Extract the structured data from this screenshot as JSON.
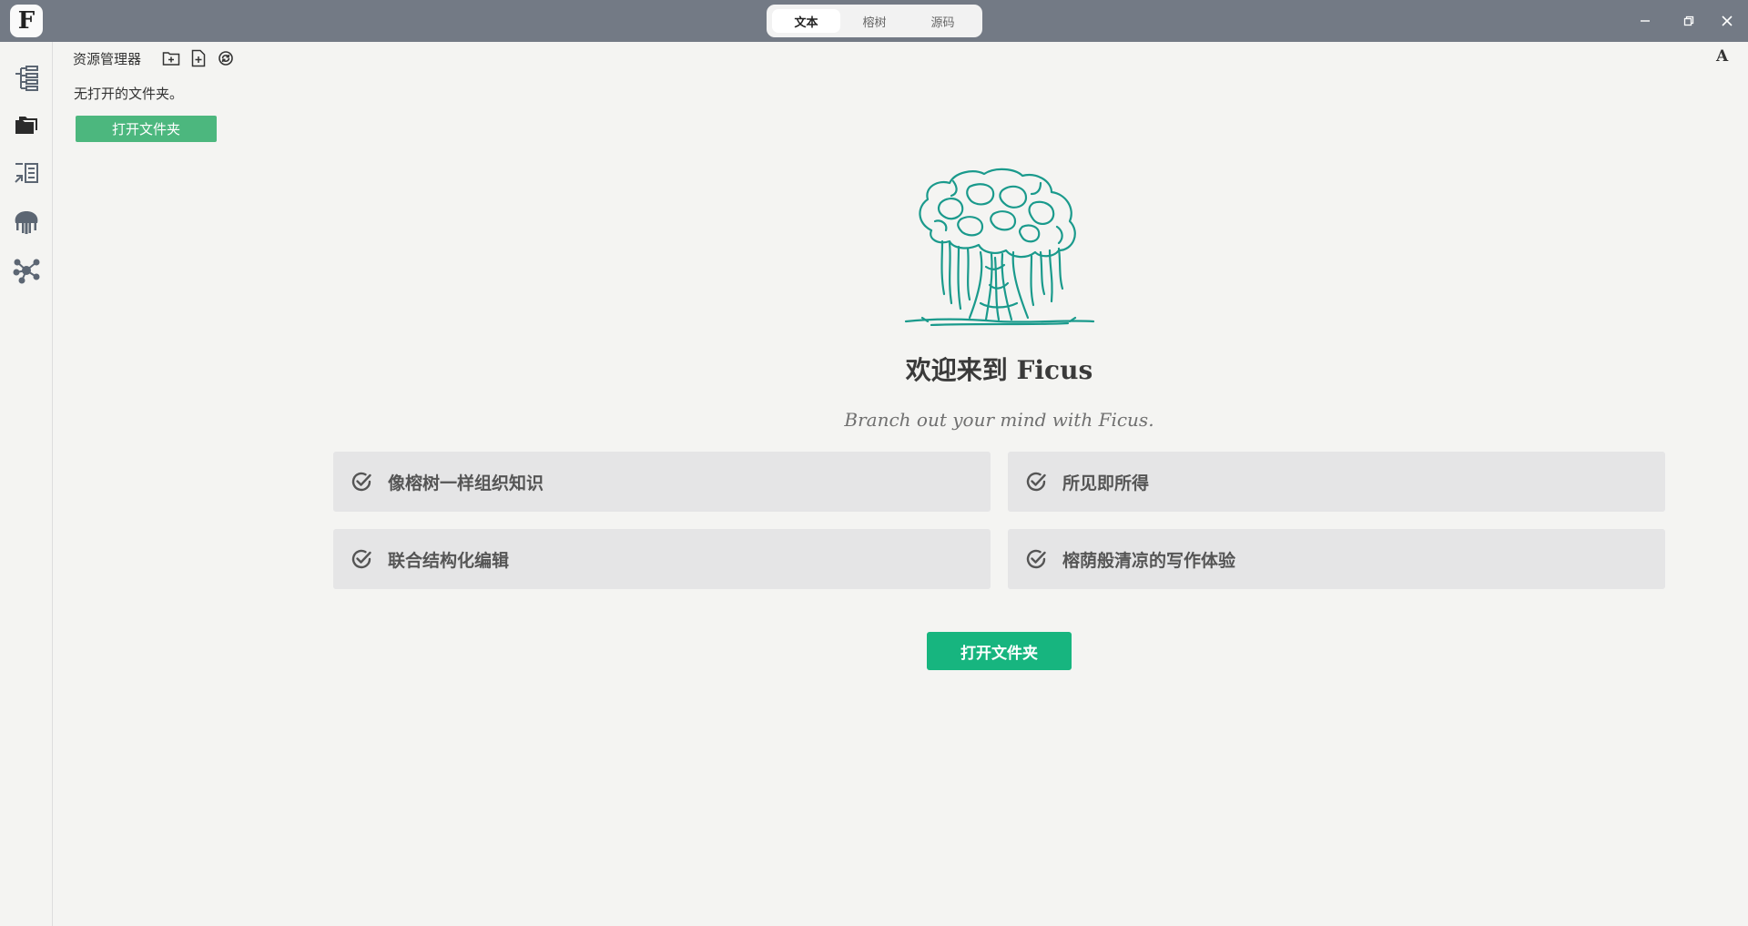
{
  "titlebar": {
    "logo_letter": "F",
    "modes": [
      {
        "label": "文本",
        "active": true
      },
      {
        "label": "榕树",
        "active": false
      },
      {
        "label": "源码",
        "active": false
      }
    ],
    "controls": [
      "minimize-icon",
      "restore-icon",
      "close-icon"
    ]
  },
  "activitybar": {
    "icons": [
      "outline-tree-icon",
      "folder-icon",
      "reader-icon",
      "banyan-icon",
      "graph-icon"
    ]
  },
  "explorer": {
    "title": "资源管理器",
    "tools": [
      "new-folder-icon",
      "new-file-icon",
      "refresh-icon"
    ],
    "empty_text": "无打开的文件夹。",
    "open_button": "打开文件夹"
  },
  "font_toggle": "A",
  "welcome": {
    "title": "欢迎来到 Ficus",
    "subtitle": "Branch out your mind with Ficus.",
    "features": [
      {
        "label": "像榕树一样组织知识"
      },
      {
        "label": "所见即所得"
      },
      {
        "label": "联合结构化编辑"
      },
      {
        "label": "榕荫般清凉的写作体验"
      }
    ],
    "open_button": "打开文件夹"
  },
  "colors": {
    "titlebar": "#737a85",
    "accent": "#17b57f",
    "sidebar_button": "#4cb77e",
    "tree": "#1a9a8c",
    "icon": "#5c6673"
  }
}
